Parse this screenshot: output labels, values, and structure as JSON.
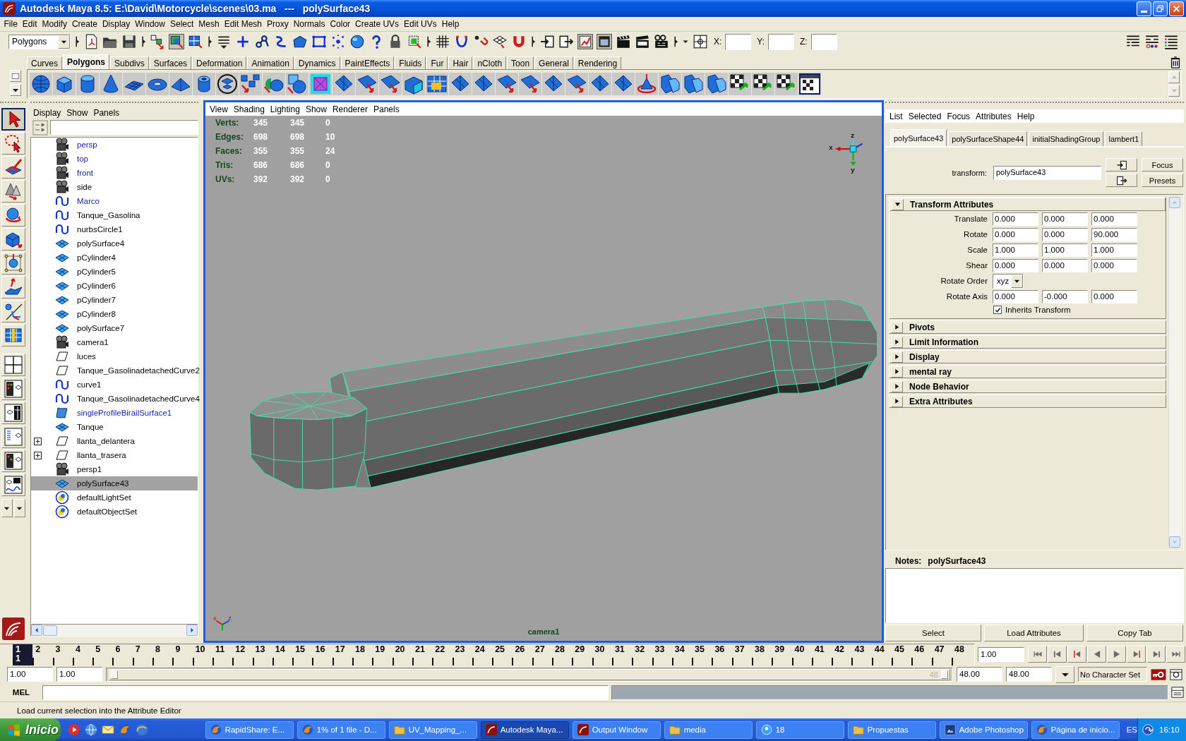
{
  "window": {
    "title": "Autodesk Maya 8.5: E:\\David\\Motorcycle\\scenes\\03.ma   ---   polySurface43"
  },
  "menu_bar": [
    "File",
    "Edit",
    "Modify",
    "Create",
    "Display",
    "Window",
    "Select",
    "Mesh",
    "Edit Mesh",
    "Proxy",
    "Normals",
    "Color",
    "Create UVs",
    "Edit UVs",
    "Help"
  ],
  "status_line": {
    "menu_set": "Polygons",
    "coordinate_fields": [
      {
        "label": "X:"
      },
      {
        "label": "Y:"
      },
      {
        "label": "Z:"
      }
    ]
  },
  "shelf_tabs": [
    {
      "label": "Curves",
      "selected": false
    },
    {
      "label": "Polygons",
      "selected": true
    },
    {
      "label": "Subdivs",
      "selected": false
    },
    {
      "label": "Surfaces",
      "selected": false
    },
    {
      "label": "Deformation",
      "selected": false
    },
    {
      "label": "Animation",
      "selected": false
    },
    {
      "label": "Dynamics",
      "selected": false
    },
    {
      "label": "PaintEffects",
      "selected": false
    },
    {
      "label": "Fluids",
      "selected": false
    },
    {
      "label": "Fur",
      "selected": false
    },
    {
      "label": "Hair",
      "selected": false
    },
    {
      "label": "nCloth",
      "selected": false
    },
    {
      "label": "Toon",
      "selected": false
    },
    {
      "label": "General",
      "selected": false
    },
    {
      "label": "Rendering",
      "selected": false
    }
  ],
  "toolbox": {
    "tools": [
      {
        "selected": true
      },
      {
        "selected": false
      },
      {
        "selected": false
      },
      {
        "selected": false
      },
      {
        "selected": false
      },
      {
        "selected": false
      },
      {
        "selected": false
      },
      {
        "selected": false
      },
      {
        "selected": false
      },
      {
        "selected": false
      }
    ]
  },
  "outliner": {
    "menu": [
      "Display",
      "Show",
      "Panels"
    ],
    "items": [
      {
        "name": "persp",
        "kind": "camera",
        "hidden": true,
        "has_children": false,
        "selected": false
      },
      {
        "name": "top",
        "kind": "camera",
        "hidden": true,
        "has_children": false,
        "selected": false
      },
      {
        "name": "front",
        "kind": "camera",
        "hidden": true,
        "has_children": false,
        "selected": false
      },
      {
        "name": "side",
        "kind": "camera",
        "hidden": false,
        "has_children": false,
        "selected": false
      },
      {
        "name": "Marco",
        "kind": "curve",
        "hidden": true,
        "has_children": false,
        "selected": false
      },
      {
        "name": "Tanque_Gasolina",
        "kind": "curve",
        "hidden": false,
        "has_children": false,
        "selected": false
      },
      {
        "name": "nurbsCircle1",
        "kind": "curve",
        "hidden": false,
        "has_children": false,
        "selected": false
      },
      {
        "name": "polySurface4",
        "kind": "mesh",
        "hidden": false,
        "has_children": false,
        "selected": false
      },
      {
        "name": "pCylinder4",
        "kind": "mesh",
        "hidden": false,
        "has_children": false,
        "selected": false
      },
      {
        "name": "pCylinder5",
        "kind": "mesh",
        "hidden": false,
        "has_children": false,
        "selected": false
      },
      {
        "name": "pCylinder6",
        "kind": "mesh",
        "hidden": false,
        "has_children": false,
        "selected": false
      },
      {
        "name": "pCylinder7",
        "kind": "mesh",
        "hidden": false,
        "has_children": false,
        "selected": false
      },
      {
        "name": "pCylinder8",
        "kind": "mesh",
        "hidden": false,
        "has_children": false,
        "selected": false
      },
      {
        "name": "polySurface7",
        "kind": "mesh",
        "hidden": false,
        "has_children": false,
        "selected": false
      },
      {
        "name": "camera1",
        "kind": "camera",
        "hidden": false,
        "has_children": false,
        "selected": false
      },
      {
        "name": "luces",
        "kind": "transform",
        "hidden": false,
        "has_children": false,
        "selected": false
      },
      {
        "name": "Tanque_GasolinadetachedCurve2",
        "kind": "transform",
        "hidden": false,
        "has_children": false,
        "selected": false
      },
      {
        "name": "curve1",
        "kind": "curve",
        "hidden": false,
        "has_children": false,
        "selected": false
      },
      {
        "name": "Tanque_GasolinadetachedCurve4",
        "kind": "curve",
        "hidden": false,
        "has_children": false,
        "selected": false
      },
      {
        "name": "singleProfileBirailSurface1",
        "kind": "surface",
        "hidden": true,
        "has_children": false,
        "selected": false
      },
      {
        "name": "Tanque",
        "kind": "mesh",
        "hidden": false,
        "has_children": false,
        "selected": false
      },
      {
        "name": "llanta_delantera",
        "kind": "transform",
        "hidden": false,
        "has_children": true,
        "selected": false
      },
      {
        "name": "llanta_trasera",
        "kind": "transform",
        "hidden": false,
        "has_children": true,
        "selected": false
      },
      {
        "name": "persp1",
        "kind": "camera",
        "hidden": false,
        "has_children": false,
        "selected": false
      },
      {
        "name": "polySurface43",
        "kind": "mesh",
        "hidden": false,
        "has_children": false,
        "selected": true
      },
      {
        "name": "defaultLightSet",
        "kind": "set",
        "hidden": false,
        "has_children": false,
        "selected": false
      },
      {
        "name": "defaultObjectSet",
        "kind": "set",
        "hidden": false,
        "has_children": false,
        "selected": false
      }
    ]
  },
  "viewport": {
    "menu": [
      "View",
      "Shading",
      "Lighting",
      "Show",
      "Renderer",
      "Panels"
    ],
    "hud": [
      {
        "label": "Verts:",
        "values": [
          "345",
          "345",
          "0"
        ]
      },
      {
        "label": "Edges:",
        "values": [
          "698",
          "698",
          "10"
        ]
      },
      {
        "label": "Faces:",
        "values": [
          "355",
          "355",
          "24"
        ]
      },
      {
        "label": "Tris:",
        "values": [
          "686",
          "686",
          "0"
        ]
      },
      {
        "label": "UVs:",
        "values": [
          "392",
          "392",
          "0"
        ]
      }
    ],
    "view_axis_labels": [
      "x",
      "z",
      "y"
    ],
    "corner_axis_labels": [
      "x",
      "z"
    ],
    "camera": "camera1"
  },
  "attribute_editor": {
    "menu": [
      "List",
      "Selected",
      "Focus",
      "Attributes",
      "Help"
    ],
    "tabs": [
      {
        "label": "polySurface43",
        "selected": true
      },
      {
        "label": "polySurfaceShape44",
        "selected": false
      },
      {
        "label": "initialShadingGroup",
        "selected": false
      },
      {
        "label": "lambert1",
        "selected": false
      }
    ],
    "node_type": "transform:",
    "node_name": "polySurface43",
    "buttons": [
      "Focus",
      "Presets"
    ],
    "sections": [
      {
        "title": "Transform Attributes",
        "expanded": true,
        "rows": [
          {
            "kind": "vector",
            "label": "Translate",
            "values": [
              "0.000",
              "0.000",
              "0.000"
            ]
          },
          {
            "kind": "vector",
            "label": "Rotate",
            "values": [
              "0.000",
              "0.000",
              "90.000"
            ]
          },
          {
            "kind": "vector",
            "label": "Scale",
            "values": [
              "1.000",
              "1.000",
              "1.000"
            ]
          },
          {
            "kind": "vector",
            "label": "Shear",
            "values": [
              "0.000",
              "0.000",
              "0.000"
            ]
          },
          {
            "kind": "dropdown",
            "label": "Rotate Order",
            "value": "xyz"
          },
          {
            "kind": "vector",
            "label": "Rotate Axis",
            "values": [
              "0.000",
              "-0.000",
              "0.000"
            ]
          },
          {
            "kind": "checkbox",
            "label": "Inherits Transform",
            "checked": true
          }
        ]
      },
      {
        "title": "Pivots",
        "expanded": false
      },
      {
        "title": "Limit Information",
        "expanded": false
      },
      {
        "title": "Display",
        "expanded": false
      },
      {
        "title": "mental ray",
        "expanded": false
      },
      {
        "title": "Node Behavior",
        "expanded": false
      },
      {
        "title": "Extra Attributes",
        "expanded": false
      }
    ],
    "notes": {
      "label": "Notes:",
      "node": "polySurface43"
    },
    "bottom_buttons": [
      "Select",
      "Load Attributes",
      "Copy Tab"
    ]
  },
  "time_slider": {
    "frames": [
      {
        "label": "1",
        "selected": true
      },
      {
        "label": "2",
        "selected": false
      },
      {
        "label": "3",
        "selected": false
      },
      {
        "label": "4",
        "selected": false
      },
      {
        "label": "5",
        "selected": false
      },
      {
        "label": "6",
        "selected": false
      },
      {
        "label": "7",
        "selected": false
      },
      {
        "label": "8",
        "selected": false
      },
      {
        "label": "9",
        "selected": false
      },
      {
        "label": "10",
        "selected": false
      },
      {
        "label": "11",
        "selected": false
      },
      {
        "label": "12",
        "selected": false
      },
      {
        "label": "13",
        "selected": false
      },
      {
        "label": "14",
        "selected": false
      },
      {
        "label": "15",
        "selected": false
      },
      {
        "label": "16",
        "selected": false
      },
      {
        "label": "17",
        "selected": false
      },
      {
        "label": "18",
        "selected": false
      },
      {
        "label": "19",
        "selected": false
      },
      {
        "label": "20",
        "selected": false
      },
      {
        "label": "21",
        "selected": false
      },
      {
        "label": "22",
        "selected": false
      },
      {
        "label": "23",
        "selected": false
      },
      {
        "label": "24",
        "selected": false
      },
      {
        "label": "25",
        "selected": false
      },
      {
        "label": "26",
        "selected": false
      },
      {
        "label": "27",
        "selected": false
      },
      {
        "label": "28",
        "selected": false
      },
      {
        "label": "29",
        "selected": false
      },
      {
        "label": "30",
        "selected": false
      },
      {
        "label": "31",
        "selected": false
      },
      {
        "label": "32",
        "selected": false
      },
      {
        "label": "33",
        "selected": false
      },
      {
        "label": "34",
        "selected": false
      },
      {
        "label": "35",
        "selected": false
      },
      {
        "label": "36",
        "selected": false
      },
      {
        "label": "37",
        "selected": false
      },
      {
        "label": "38",
        "selected": false
      },
      {
        "label": "39",
        "selected": false
      },
      {
        "label": "40",
        "selected": false
      },
      {
        "label": "41",
        "selected": false
      },
      {
        "label": "42",
        "selected": false
      },
      {
        "label": "43",
        "selected": false
      },
      {
        "label": "44",
        "selected": false
      },
      {
        "label": "45",
        "selected": false
      },
      {
        "label": "46",
        "selected": false
      },
      {
        "label": "47",
        "selected": false
      },
      {
        "label": "48",
        "selected": false
      }
    ],
    "marker_label": "1",
    "current_time": "1.00"
  },
  "range_slider": {
    "start_time": "1.00",
    "range_start": "1.00",
    "level": 1,
    "range_end_label": "48",
    "range_end": "48.00",
    "end_time": "48.00",
    "character_set": "No Character Set"
  },
  "command_line": {
    "language": "MEL"
  },
  "help_line": "Load current selection into the Attribute Editor",
  "taskbar": {
    "start": "Inicio",
    "tasks": [
      {
        "label": "RapidShare: E...",
        "kind": "browser",
        "selected": false
      },
      {
        "label": "1% of 1 file - D...",
        "kind": "browser",
        "selected": false
      },
      {
        "label": "UV_Mapping_...",
        "kind": "folder",
        "selected": false
      },
      {
        "label": "Autodesk Maya...",
        "kind": "app",
        "selected": true
      },
      {
        "label": "Output Window",
        "kind": "app",
        "selected": false
      },
      {
        "label": "media",
        "kind": "folder",
        "selected": false
      },
      {
        "label": "18",
        "kind": "chat",
        "selected": false
      },
      {
        "label": "Propuestas",
        "kind": "folder",
        "selected": false
      },
      {
        "label": "Adobe Photoshop",
        "kind": "image",
        "selected": false
      },
      {
        "label": "Página de inicio...",
        "kind": "browser",
        "selected": false
      }
    ],
    "language": "ES",
    "clock": "16:10"
  }
}
